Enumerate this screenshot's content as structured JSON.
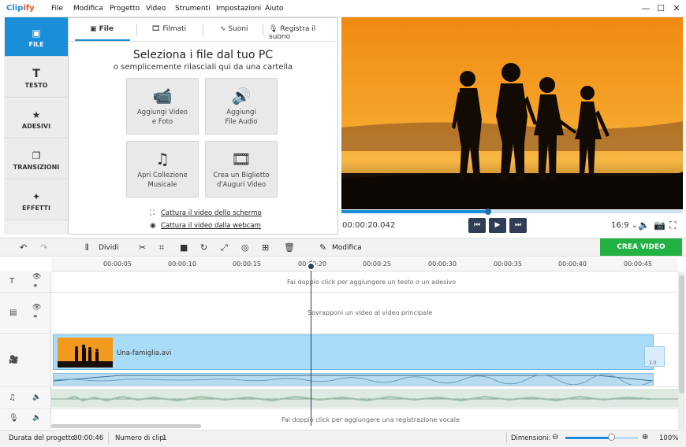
{
  "app": {
    "logo_main": "Clip",
    "logo_accent": "ify"
  },
  "menu": [
    "File",
    "Modifica",
    "Progetto",
    "Video",
    "Strumenti",
    "Impostazioni",
    "Aiuto"
  ],
  "window_controls": {
    "minimize": "—",
    "maximize": "☐",
    "close": "✕"
  },
  "left_tabs": [
    {
      "label": "FILE",
      "icon": "image-icon",
      "glyph": "▣"
    },
    {
      "label": "TESTO",
      "icon": "text-icon",
      "glyph": "T"
    },
    {
      "label": "ADESIVI",
      "icon": "star-icon",
      "glyph": "★"
    },
    {
      "label": "TRANSIZIONI",
      "icon": "transitions-icon",
      "glyph": "❐"
    },
    {
      "label": "EFFETTI",
      "icon": "wand-icon",
      "glyph": "✦"
    }
  ],
  "sub_tabs": [
    {
      "label": "File",
      "glyph": "▣"
    },
    {
      "label": "Filmati",
      "glyph": "🎞"
    },
    {
      "label": "Suoni",
      "glyph": "∿"
    },
    {
      "label": "Registra il suono",
      "glyph": "🎙"
    }
  ],
  "panel": {
    "heading": "Seleziona i file dal tuo PC",
    "subheading": "o semplicemente rilasciali qui da una cartella",
    "tiles": [
      {
        "line1": "Aggiungi Video",
        "line2": "e Foto",
        "glyph": "📹"
      },
      {
        "line1": "Aggiungi",
        "line2": "File Audio",
        "glyph": "🔊"
      },
      {
        "line1": "Apri Collezione",
        "line2": "Musicale",
        "glyph": "♫"
      },
      {
        "line1": "Crea un Biglietto",
        "line2": "d'Auguri Video",
        "glyph": "🎞"
      }
    ],
    "capture_screen": "Cattura il video dello schermo",
    "capture_webcam": "Cattura il video dalla webcam"
  },
  "player": {
    "timecode": "00:00:20.042",
    "progress": 0.43,
    "ratio": "16:9 ⌄",
    "btn_prev": "⏮",
    "btn_play": "▶",
    "btn_next": "⏭"
  },
  "toolbar": {
    "undo": "↶",
    "redo": "↷",
    "split_label": "Dividi",
    "edit_label": "Modifica",
    "create_label": "CREA VIDEO"
  },
  "ruler_ticks": [
    "00:00:05",
    "00:00:10",
    "00:00:15",
    "00:00:20",
    "00:00:25",
    "00:00:30",
    "00:00:35",
    "00:00:40",
    "00:00:45"
  ],
  "timeline": {
    "text_hint": "Fai doppio click per aggiungere un testo o un adesivo",
    "overlay_hint": "Sovrapponi un video al video principale",
    "clip_name": "Una-famiglia.avi",
    "transition_label": "2.0",
    "voice_hint": "Fai doppio click per aggiungere una registrazione vocale"
  },
  "status": {
    "duration_label": "Durata del progetto:",
    "duration_value": "00:00:46",
    "clips_label": "Numero di clip:",
    "clips_value": "1",
    "zoom_label": "Dimensioni:",
    "zoom_value": "100%",
    "zoom_fraction": 0.63
  },
  "colors": {
    "accent": "#1a8ed8",
    "create": "#22b142",
    "clip": "#a9dcf6",
    "sunset": "#f39c1d"
  }
}
